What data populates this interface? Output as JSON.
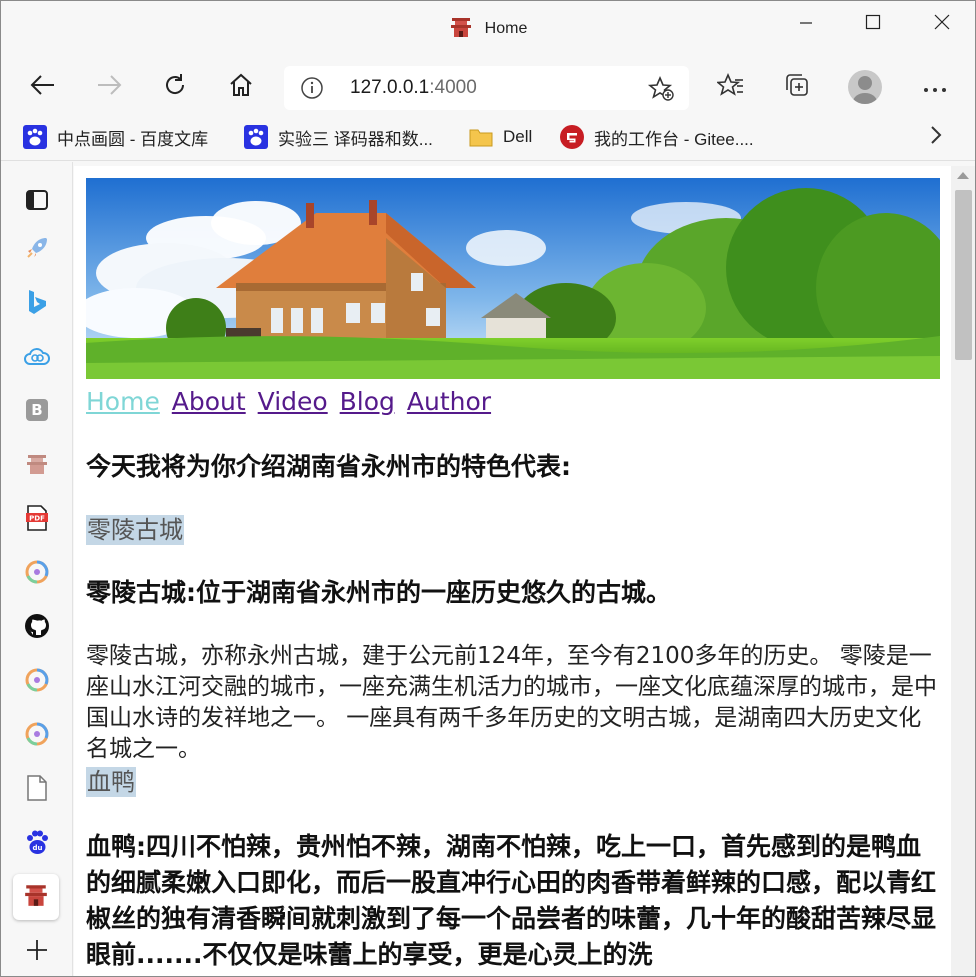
{
  "window": {
    "title": "Home"
  },
  "toolbar": {
    "address_host": "127.0.0.1",
    "address_port": ":4000"
  },
  "bookmarks": [
    {
      "label": "中点画圆 - 百度文库",
      "icon": "baidu-paw-icon"
    },
    {
      "label": "实验三 译码器和数...",
      "icon": "baidu-paw-icon"
    },
    {
      "label": "Dell",
      "icon": "folder-icon"
    },
    {
      "label": "我的工作台 - Gitee....",
      "icon": "gitee-icon"
    }
  ],
  "sidebar": {
    "items": [
      "tabs-icon",
      "rocket-icon",
      "bing-icon",
      "cloud-icon",
      "b-badge-icon",
      "pagoda-icon",
      "pdf-icon",
      "loop-app-icon",
      "github-icon",
      "loop-app-icon",
      "loop-app-icon",
      "file-icon",
      "baidu-paw-icon",
      "pagoda-icon",
      "plus-icon"
    ]
  },
  "page": {
    "nav": [
      {
        "label": "Home",
        "current": true
      },
      {
        "label": "About",
        "current": false
      },
      {
        "label": "Video",
        "current": false
      },
      {
        "label": "Blog",
        "current": false
      },
      {
        "label": "Author",
        "current": false
      }
    ],
    "intro_heading": "今天我将为你介绍湖南省永州市的特色代表:",
    "link1": "零陵古城",
    "heading1": "零陵古城:位于湖南省永州市的一座历史悠久的古城。",
    "paragraph1": "零陵古城，亦称永州古城，建于公元前124年，至今有2100多年的历史。 零陵是一座山水江河交融的城市，一座充满生机活力的城市，一座文化底蕴深厚的城市，是中国山水诗的发祥地之一。 一座具有两千多年历史的文明古城，是湖南四大历史文化名城之一。",
    "link2": "血鸭",
    "heading2": "血鸭:四川不怕辣，贵州怕不辣，湖南不怕辣，吃上一口，首先感到的是鸭血的细腻柔嫩入口即化，而后一股直冲行心田的肉香带着鲜辣的口感，配以青红椒丝的独有清香瞬间就刺激到了每一个品尝者的味蕾，几十年的酸甜苦辣尽显眼前.......不仅仅是味蕾上的享受，更是心灵上的洗"
  },
  "colors": {
    "link_visited": "#551a8b",
    "link_current": "#7fd6d6",
    "highlight": "#c4d7e6"
  }
}
